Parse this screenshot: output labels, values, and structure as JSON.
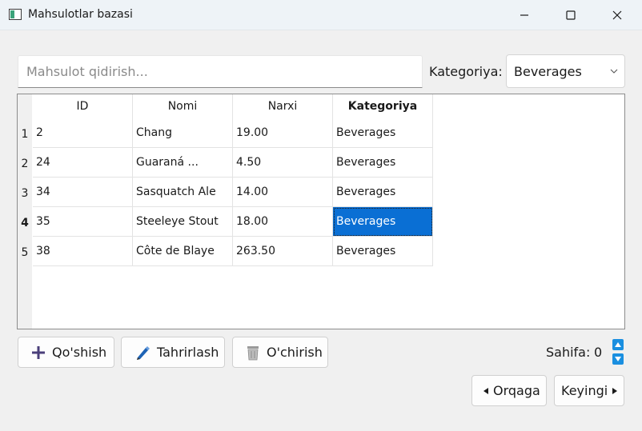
{
  "window": {
    "title": "Mahsulotlar bazasi"
  },
  "search": {
    "placeholder": "Mahsulot qidirish..."
  },
  "category_filter": {
    "label": "Kategoriya:",
    "selected": "Beverages"
  },
  "table": {
    "columns": [
      "ID",
      "Nomi",
      "Narxi",
      "Kategoriya"
    ],
    "sorted_column": "Kategoriya",
    "row_numbers": [
      "1",
      "2",
      "3",
      "4",
      "5"
    ],
    "current_row": 4,
    "rows": [
      [
        "2",
        "Chang",
        "19.00",
        "Beverages"
      ],
      [
        "24",
        "Guaraná ...",
        "4.50",
        "Beverages"
      ],
      [
        "34",
        "Sasquatch Ale",
        "14.00",
        "Beverages"
      ],
      [
        "35",
        "Steeleye Stout",
        "18.00",
        "Beverages"
      ],
      [
        "38",
        "Côte de Blaye",
        "263.50",
        "Beverages"
      ]
    ]
  },
  "actions": {
    "add": "Qo'shish",
    "edit": "Tahrirlash",
    "delete": "O'chirish"
  },
  "pagination": {
    "label": "Sahifa:",
    "value": "0",
    "prev": "Orqaga",
    "next": "Keyingi"
  },
  "colors": {
    "selection": "#0a6fd4",
    "accent": "#1a8fe0",
    "titlebar": "#eef3f7"
  }
}
